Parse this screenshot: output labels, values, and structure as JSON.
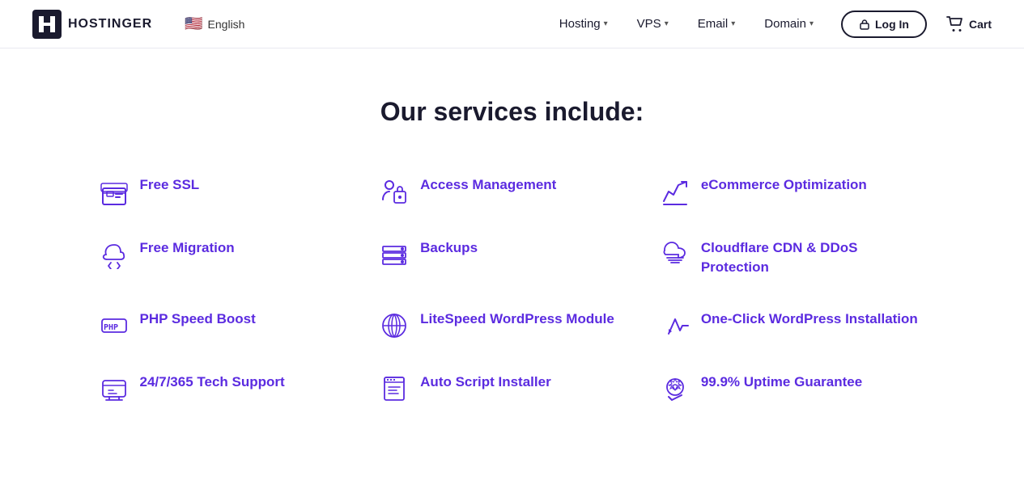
{
  "brand": {
    "logo_text": "HOSTINGER",
    "logo_icon": "H"
  },
  "navbar": {
    "lang_flag": "🇺🇸",
    "lang_label": "English",
    "nav_items": [
      {
        "label": "Hosting",
        "has_dropdown": true
      },
      {
        "label": "VPS",
        "has_dropdown": true
      },
      {
        "label": "Email",
        "has_dropdown": true
      },
      {
        "label": "Domain",
        "has_dropdown": true
      }
    ],
    "login_label": "Log In",
    "cart_label": "Cart"
  },
  "main": {
    "section_title": "Our services include:",
    "services": [
      {
        "id": "free-ssl",
        "label": "Free SSL",
        "icon": "ssl"
      },
      {
        "id": "access-management",
        "label": "Access Management",
        "icon": "access"
      },
      {
        "id": "ecommerce-optimization",
        "label": "eCommerce Optimization",
        "icon": "ecommerce"
      },
      {
        "id": "free-migration",
        "label": "Free Migration",
        "icon": "migration"
      },
      {
        "id": "backups",
        "label": "Backups",
        "icon": "backups"
      },
      {
        "id": "cloudflare-cdn",
        "label": "Cloudflare CDN & DDoS Protection",
        "icon": "cloudflare"
      },
      {
        "id": "php-speed-boost",
        "label": "PHP Speed Boost",
        "icon": "php"
      },
      {
        "id": "litespeed-wordpress",
        "label": "LiteSpeed WordPress Module",
        "icon": "wordpress"
      },
      {
        "id": "one-click-wordpress",
        "label": "One-Click WordPress Installation",
        "icon": "oneclick"
      },
      {
        "id": "tech-support",
        "label": "24/7/365 Tech Support",
        "icon": "support"
      },
      {
        "id": "auto-script",
        "label": "Auto Script Installer",
        "icon": "script"
      },
      {
        "id": "uptime-guarantee",
        "label": "99.9% Uptime Guarantee",
        "icon": "uptime"
      }
    ]
  }
}
